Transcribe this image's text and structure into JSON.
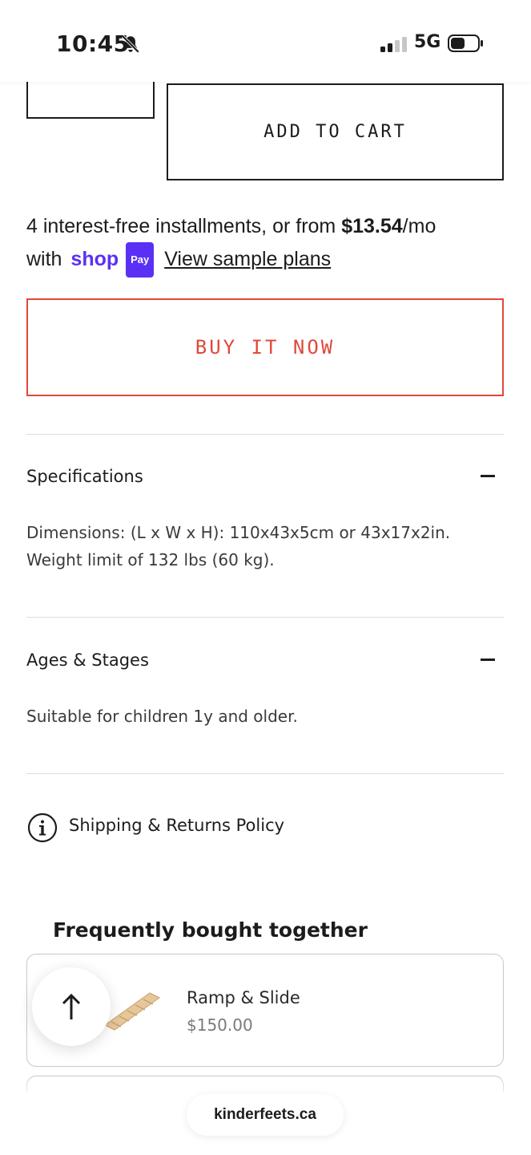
{
  "status_bar": {
    "time": "10:45",
    "network": "5G",
    "icons": [
      "bell-slash-icon",
      "signal-icon",
      "battery-icon"
    ]
  },
  "product_actions": {
    "add_to_cart_label": "ADD TO CART",
    "buy_now_label": "BUY IT NOW"
  },
  "installments": {
    "text_before": "4 interest-free installments, or from ",
    "amount": "$13.54",
    "text_after": "/mo",
    "with_label": "with",
    "shop_logo": "shop",
    "pay_badge": "Pay",
    "link_label": "View sample plans"
  },
  "accordions": [
    {
      "title": "Specifications",
      "body": "Dimensions: (L x W x H): 110x43x5cm or 43x17x2in. Weight limit of 132 lbs (60 kg)."
    },
    {
      "title": "Ages & Stages",
      "body": "Suitable for children 1y and older."
    }
  ],
  "shipping_link": "Shipping & Returns Policy",
  "frequently_bought": {
    "title": "Frequently bought together",
    "products": [
      {
        "name": "Ramp & Slide",
        "price": "$150.00"
      }
    ]
  },
  "browser": {
    "url": "kinderfeets.ca"
  },
  "colors": {
    "accent_red": "#e0483a",
    "shop_purple": "#5a31f4",
    "text_dark": "#1c1c1c"
  }
}
